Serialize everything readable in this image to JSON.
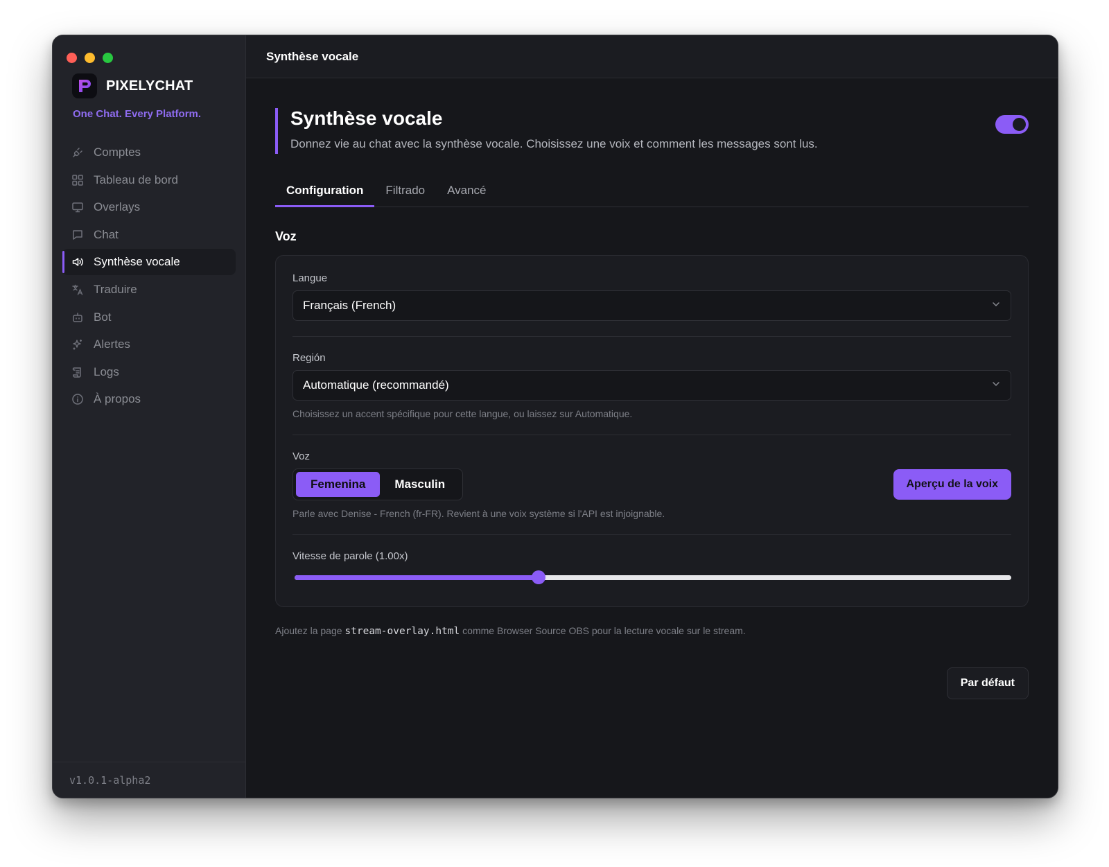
{
  "window": {
    "topbar_title": "Synthèse vocale"
  },
  "brand": {
    "name": "PIXELYCHAT",
    "tagline": "One Chat. Every Platform.",
    "accent": "#8b5cf6"
  },
  "sidebar": {
    "items": [
      {
        "label": "Comptes",
        "icon": "plug-icon",
        "active": false
      },
      {
        "label": "Tableau de bord",
        "icon": "grid-icon",
        "active": false
      },
      {
        "label": "Overlays",
        "icon": "monitor-icon",
        "active": false
      },
      {
        "label": "Chat",
        "icon": "chat-bubble-icon",
        "active": false
      },
      {
        "label": "Synthèse vocale",
        "icon": "speaker-icon",
        "active": true
      },
      {
        "label": "Traduire",
        "icon": "translate-icon",
        "active": false
      },
      {
        "label": "Bot",
        "icon": "bot-icon",
        "active": false
      },
      {
        "label": "Alertes",
        "icon": "sparkles-icon",
        "active": false
      },
      {
        "label": "Logs",
        "icon": "scroll-icon",
        "active": false
      },
      {
        "label": "À propos",
        "icon": "info-icon",
        "active": false
      }
    ],
    "version": "v1.0.1-alpha2"
  },
  "header": {
    "title": "Synthèse vocale",
    "subtitle": "Donnez vie au chat avec la synthèse vocale. Choisissez une voix et comment les messages sont lus.",
    "enabled": true
  },
  "tabs": [
    {
      "label": "Configuration",
      "active": true
    },
    {
      "label": "Filtrado",
      "active": false
    },
    {
      "label": "Avancé",
      "active": false
    }
  ],
  "voice_section": {
    "title": "Voz",
    "language": {
      "label": "Langue",
      "value": "Français (French)"
    },
    "region": {
      "label": "Región",
      "value": "Automatique (recommandé)",
      "hint": "Choisissez un accent spécifique pour cette langue, ou laissez sur Automatique."
    },
    "voice": {
      "label": "Voz",
      "options": [
        "Femenina",
        "Masculin"
      ],
      "selected": "Femenina",
      "preview_button": "Aperçu de la voix",
      "hint": "Parle avec Denise - French (fr-FR). Revient à une voix système si l'API est injoignable."
    },
    "speed": {
      "label": "Vitesse de parole (1.00x)",
      "value_fraction": 0.34
    }
  },
  "footnote": {
    "prefix": "Ajoutez la page ",
    "code": "stream-overlay.html",
    "suffix": " comme Browser Source OBS pour la lecture vocale sur le stream."
  },
  "default_button": "Par défaut"
}
